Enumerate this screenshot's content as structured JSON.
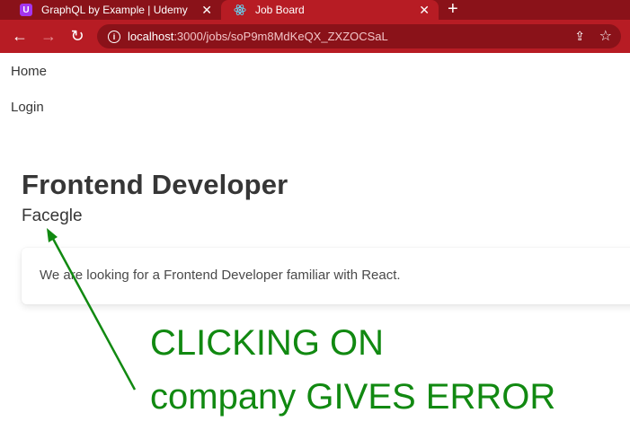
{
  "browser": {
    "tabs": [
      {
        "title": "GraphQL by Example | Udemy",
        "favicon": "udemy-icon"
      },
      {
        "title": "Job Board",
        "favicon": "react-icon",
        "active": true
      }
    ],
    "new_tab": "+",
    "url_host": "localhost",
    "url_path": ":3000/jobs/soP9m8MdKeQX_ZXZOCSaL"
  },
  "nav": {
    "home": "Home",
    "login": "Login"
  },
  "job": {
    "title": "Frontend Developer",
    "company": "Facegle",
    "description": "We are looking for a Frontend Developer familiar with React."
  },
  "annotation": {
    "line1": "CLICKING ON",
    "line2": "company GIVES ERROR",
    "color": "#118911"
  }
}
